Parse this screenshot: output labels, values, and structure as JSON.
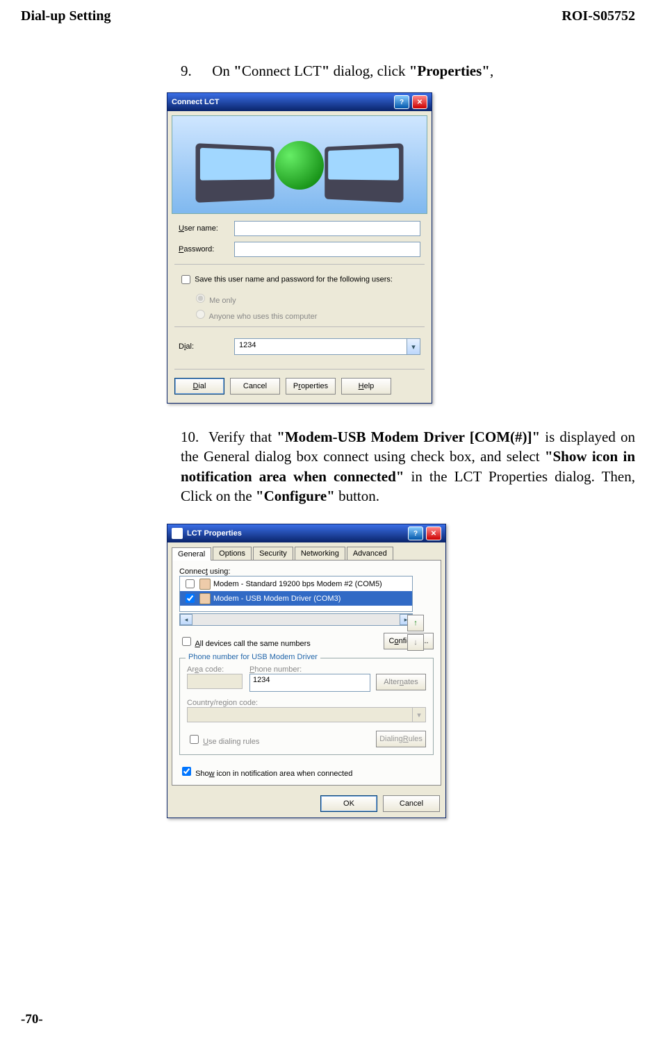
{
  "header": {
    "left": "Dial-up Setting",
    "right": "ROI-S05752"
  },
  "footer": "-70-",
  "step9": {
    "num": "9.",
    "pre": "On ",
    "q1": "\"",
    "connect_lct": "Connect LCT",
    "q2": "\"",
    "mid": " dialog, click ",
    "q3": "\"Properties\"",
    "post": ","
  },
  "connect_dialog": {
    "title": "Connect LCT",
    "username_label": "User name:",
    "password_label": "Password:",
    "save_chk": "Save this user name and password for the following users:",
    "me_only": "Me only",
    "anyone": "Anyone who uses this computer",
    "dial_label": "Dial:",
    "dial_value": "1234",
    "btn_dial": "Dial",
    "btn_cancel": "Cancel",
    "btn_props": "Properties",
    "btn_help": "Help"
  },
  "step10": {
    "num": "10.",
    "t1": "Verify that ",
    "b1": "\"Modem-USB Modem Driver [COM(#)]\"",
    "t2": " is displayed on the General dialog box connect using check box, and select ",
    "b2": "\"Show icon in notification area when connected\"",
    "t3": " in the LCT Properties dialog. Then, Click on the ",
    "b3": "\"Configure\"",
    "t4": " button."
  },
  "props_dialog": {
    "title": "LCT Properties",
    "tabs": [
      "General",
      "Options",
      "Security",
      "Networking",
      "Advanced"
    ],
    "connect_using": "Connect using:",
    "modem1": "Modem - Standard 19200 bps Modem #2 (COM5)",
    "modem2": "Modem - USB Modem Driver (COM3)",
    "all_devices": "All devices call the same numbers",
    "configure_btn": "Configure...",
    "group_title": "Phone number for USB Modem Driver",
    "area_code": "Area code:",
    "phone_number": "Phone number:",
    "phone_value": "1234",
    "alternates": "Alternates",
    "country": "Country/region code:",
    "use_rules": "Use dialing rules",
    "dialing_rules": "Dialing Rules",
    "show_icon": "Show icon in notification area when connected",
    "ok": "OK",
    "cancel": "Cancel",
    "up_icon": "↑",
    "down_icon": "↓"
  }
}
